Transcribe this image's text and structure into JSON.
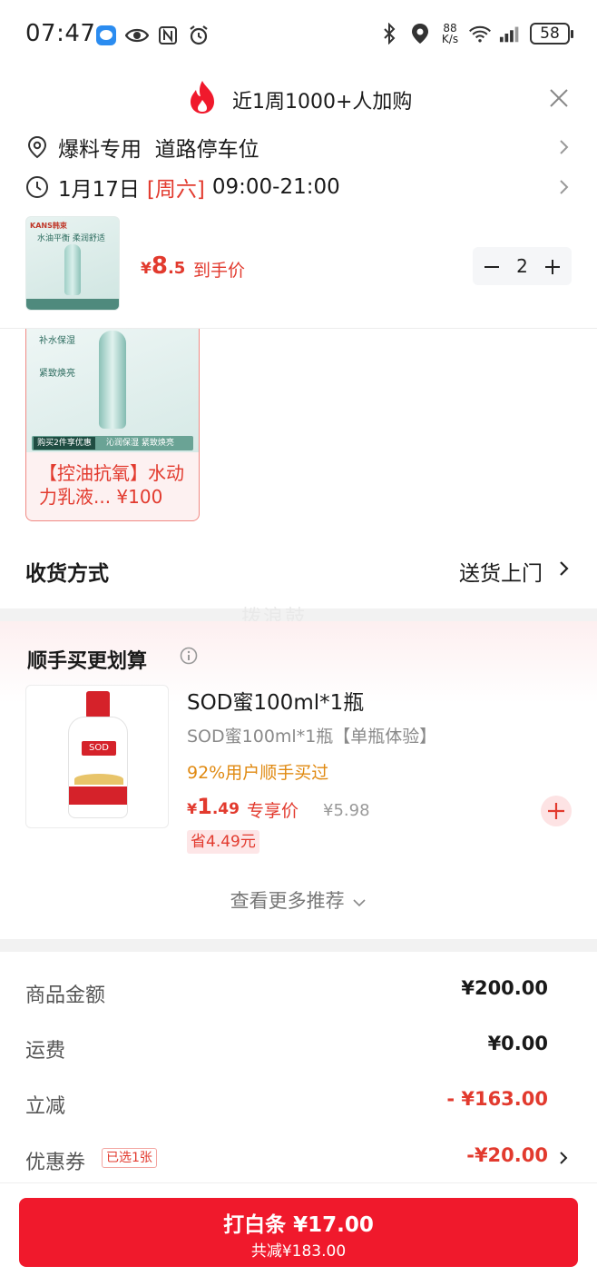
{
  "status_bar": {
    "time": "07:47",
    "net_speed_value": "88",
    "net_speed_unit": "K/s",
    "battery": "58",
    "icons": [
      "message-app-icon",
      "eye-icon",
      "nfc-icon",
      "alarm-icon",
      "bluetooth-icon",
      "location-icon",
      "wifi-6-icon",
      "signal-icon",
      "battery-icon"
    ]
  },
  "banner": {
    "text": "近1周1000+人加购",
    "icon": "fire-icon",
    "close_icon": "close-icon"
  },
  "address": {
    "text": "爆料专用  道路停车位"
  },
  "schedule": {
    "date": "1月17日",
    "weekday": "[周六]",
    "time_range": "09:00-21:00"
  },
  "product": {
    "thumb_brand": "KANS韩束",
    "thumb_title": "水油平衡  柔润舒适",
    "thumb_foot": "沁润保湿  紧致焕亮",
    "price_currency": "¥",
    "price_int": "8",
    "price_dec": ".5",
    "price_label": "到手价",
    "quantity": "2"
  },
  "gift": {
    "tag1": "补水保湿",
    "tag2": "紧致焕亮",
    "buy_tag": "购买2件享优惠",
    "ad_text": "沁润保湿  紧致焕亮",
    "name": "【控油抗氧】水动力乳液... ¥100"
  },
  "delivery": {
    "label": "收货方式",
    "value": "送货上门"
  },
  "watermark": "拨浪鼓",
  "addon": {
    "title": "顺手买更划算",
    "item": {
      "bottle_logo": "SOD",
      "name": "SOD蜜100ml*1瓶",
      "subtitle": "SOD蜜100ml*1瓶【单瓶体验】",
      "ratio": "92%用户顺手买过",
      "price_currency": "¥",
      "price_int": "1",
      "price_dec": ".49",
      "price_label": "专享价",
      "original_price": "¥5.98",
      "save_text": "省4.49元"
    },
    "more_label": "查看更多推荐"
  },
  "summary": {
    "goods_label": "商品金额",
    "goods_value": "¥200.00",
    "shipping_label": "运费",
    "shipping_value": "¥0.00",
    "discount_label": "立减",
    "discount_value": "- ¥163.00",
    "coupon_label": "优惠券",
    "coupon_badge": "已选1张",
    "coupon_value": "-¥20.00"
  },
  "pay": {
    "main": "打白条 ¥17.00",
    "sub": "共减¥183.00"
  },
  "colors": {
    "accent_red": "#f0192c",
    "price_red": "#e23a2e",
    "orange": "#e08a12"
  }
}
